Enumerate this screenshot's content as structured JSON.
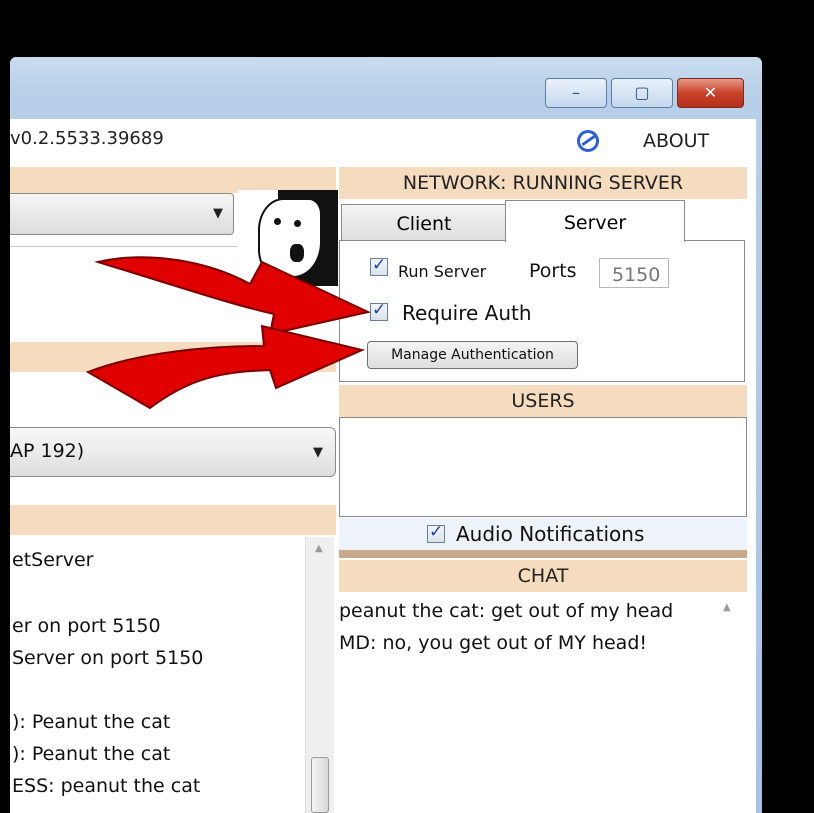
{
  "window": {
    "version": "v0.2.5533.39689",
    "about_label": "ABOUT",
    "controls": {
      "minimize": "–",
      "maximize": "▢",
      "close": "✕"
    }
  },
  "network": {
    "header": "NETWORK: RUNNING SERVER",
    "tabs": [
      {
        "label": "Client"
      },
      {
        "label": "Server"
      }
    ],
    "server": {
      "run_server_label": "Run Server",
      "run_server_checked": true,
      "ports_label": "Ports",
      "ports_value": "5150",
      "require_auth_label": "Require Auth",
      "require_auth_checked": true,
      "manage_auth_label": "Manage Authentication"
    }
  },
  "users": {
    "header": "USERS"
  },
  "notifications": {
    "audio_label": "Audio Notifications",
    "audio_checked": true
  },
  "chat": {
    "header": "CHAT",
    "messages": [
      "peanut the cat: get out of my head",
      "MD: no, you get out of MY head!"
    ]
  },
  "left_panel": {
    "device_dropdown": "AP 192)",
    "log_lines": [
      "etServer",
      "er on port 5150",
      " Server on port 5150",
      "): Peanut the cat",
      "): Peanut the cat",
      "ESS: peanut the cat"
    ]
  },
  "colors": {
    "band": "#f6dcbf",
    "arrow": "#e00000",
    "check": "#1f3ea6"
  }
}
